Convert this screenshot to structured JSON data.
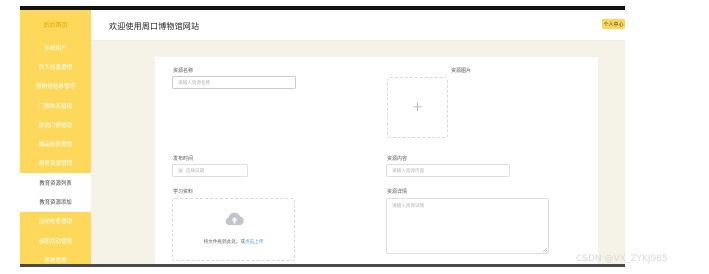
{
  "header": {
    "site_title": "欢迎使用周口博物馆网站",
    "user_center": "个人中心"
  },
  "sidebar": {
    "items": [
      {
        "label": "后台首页"
      },
      {
        "label": "系统用户"
      },
      {
        "label": "员工信息管理"
      },
      {
        "label": "博物馆信息管理"
      },
      {
        "label": "门票购买管理"
      },
      {
        "label": "取消门票管理"
      },
      {
        "label": "藏品信息管理"
      },
      {
        "label": "教育资源管理"
      },
      {
        "label": "教育资源列表"
      },
      {
        "label": "教育资源添加"
      },
      {
        "label": "活动信息管理"
      },
      {
        "label": "参团活动管理"
      },
      {
        "label": "系统管理"
      }
    ]
  },
  "form": {
    "resource_name": {
      "label": "资源名称",
      "placeholder": "请输入资源名称"
    },
    "resource_image": {
      "label": "资源图片"
    },
    "publish_time": {
      "label": "发布时间",
      "placeholder": "选择日期"
    },
    "resource_content": {
      "label": "资源内容",
      "placeholder": "请输入资源内容"
    },
    "study_material": {
      "label": "学习资料",
      "drop_text": "将文件拖到此处，或",
      "drop_link": "点击上传"
    },
    "resource_detail": {
      "label": "资源详情",
      "placeholder": "请输入资源详情"
    }
  },
  "icons": {
    "upload_plus": "plus-icon",
    "cloud": "cloud-upload-icon",
    "calendar": "calendar-icon"
  },
  "colors": {
    "accent": "#fdd85a",
    "link": "#409eff",
    "main_bg": "#f5f3e8"
  },
  "watermark": "CSDN @VX_ZYKJ985"
}
